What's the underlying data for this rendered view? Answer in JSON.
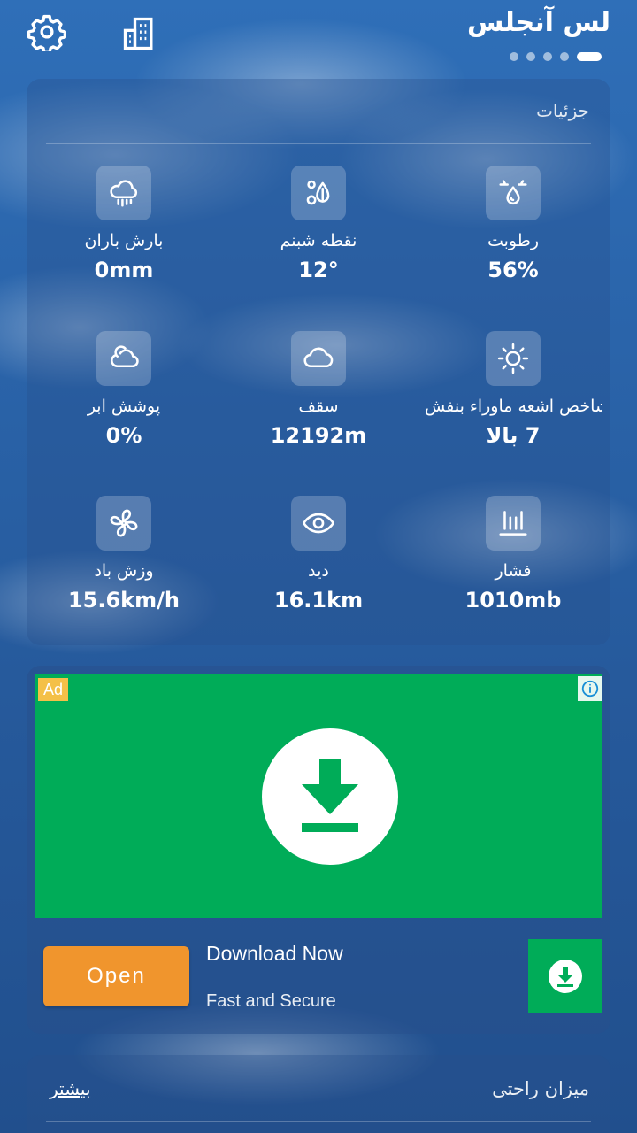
{
  "header": {
    "city": "لس آنجلس",
    "page_count": 5,
    "active_page": 5
  },
  "details": {
    "title": "جزئیات",
    "items": [
      {
        "label": "رطوبت",
        "value": "56%",
        "icon": "humidity-icon"
      },
      {
        "label": "نقطه شبنم",
        "value": "12°",
        "icon": "dew-point-icon"
      },
      {
        "label": "بارش باران",
        "value": "0mm",
        "icon": "rain-cloud-icon"
      },
      {
        "label": "شاخص اشعه ماوراء بنفش",
        "value": "7 بالا",
        "icon": "sun-icon"
      },
      {
        "label": "سقف",
        "value": "12192m",
        "icon": "cloud-ceiling-icon"
      },
      {
        "label": "پوشش ابر",
        "value": "0%",
        "icon": "cloud-cover-icon"
      },
      {
        "label": "فشار",
        "value": "1010mb",
        "icon": "pressure-icon"
      },
      {
        "label": "دید",
        "value": "16.1km",
        "icon": "visibility-eye-icon"
      },
      {
        "label": "وزش باد",
        "value": "15.6km/h",
        "icon": "wind-fan-icon"
      }
    ]
  },
  "ad": {
    "badge": "Ad",
    "title": "Download Now",
    "subtitle": "Fast and Secure",
    "button": "Open",
    "color": "#00ac58",
    "button_color": "#f0952d"
  },
  "comfort": {
    "title": "میزان راحتی",
    "more": "بیشتر"
  }
}
